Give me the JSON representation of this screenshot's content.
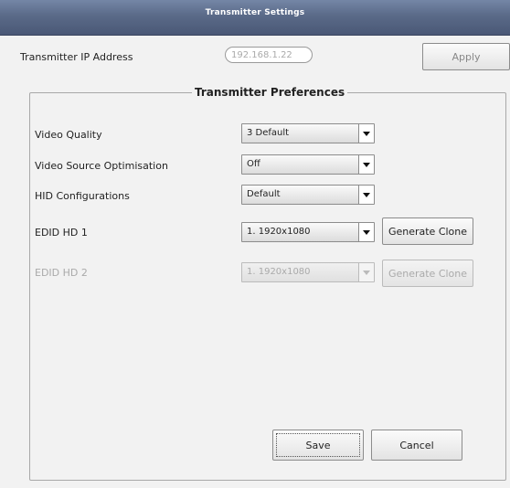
{
  "window": {
    "title": "Transmitter Settings"
  },
  "ip": {
    "label": "Transmitter IP Address",
    "value": "192.168.1.22",
    "apply_label": "Apply"
  },
  "preferences": {
    "group_title": "Transmitter Preferences",
    "rows": [
      {
        "label": "Video Quality",
        "value": "3 Default",
        "enabled": true
      },
      {
        "label": "Video Source Optimisation",
        "value": "Off",
        "enabled": true
      },
      {
        "label": "HID Configurations",
        "value": "Default",
        "enabled": true
      },
      {
        "label": "EDID HD 1",
        "value": "1. 1920x1080",
        "enabled": true,
        "button": "Generate Clone"
      },
      {
        "label": "EDID HD 2",
        "value": "1. 1920x1080",
        "enabled": false,
        "button": "Generate Clone"
      }
    ]
  },
  "footer": {
    "save_label": "Save",
    "cancel_label": "Cancel"
  },
  "colors": {
    "titlebar": "#5a6a88",
    "background": "#f2f2f2",
    "disabled_text": "#aaaaaa"
  },
  "icons": {
    "dropdown": "chevron-down-icon"
  }
}
